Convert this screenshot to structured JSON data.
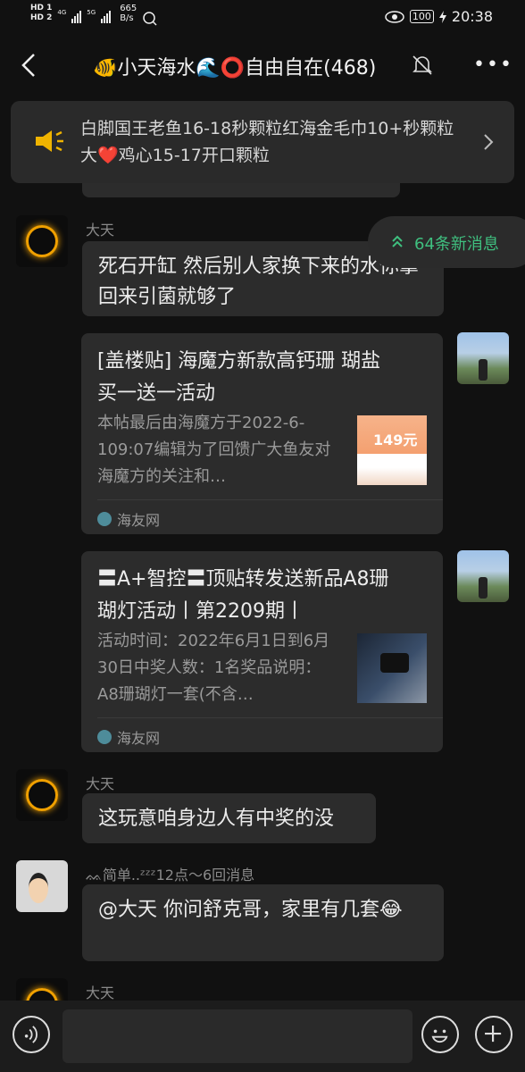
{
  "status_bar": {
    "hd1": "HD 1",
    "hd2": "HD 2",
    "net1": "4G",
    "net2": "5G",
    "speed_value": "665",
    "speed_unit": "B/s",
    "battery": "100",
    "time": "20:38"
  },
  "header": {
    "title": "🐠小天海水🌊⭕自由自在(468)"
  },
  "notice": {
    "text": "白脚国王老鱼16-18秒颗粒红海金毛巾10+秒颗粒大❤️鸡心15-17开口颗粒"
  },
  "new_messages": {
    "label": "64条新消息"
  },
  "messages": [
    {
      "sender": "大天",
      "text": "死石开缸 然后别人家换下来的水你拿回来引菌就够了"
    },
    {
      "card_title": "[盖楼贴] 海魔方新款高钙珊 瑚盐 买一送一活动",
      "card_desc": "本帖最后由海魔方于2022-6-109:07编辑为了回馈广大鱼友对海魔方的关注和…",
      "card_thumb_text": "149元",
      "card_source": "海友网"
    },
    {
      "card_title": "〓A+智控〓顶贴转发送新品A8珊瑚灯活动丨第2209期丨",
      "card_desc": "活动时间：2022年6月1日到6月30日中奖人数：1名奖品说明：A8珊瑚灯一套(不含…",
      "card_source": "海友网"
    },
    {
      "sender": "大天",
      "text": "这玩意咱身边人有中奖的没"
    },
    {
      "sender": "ᨐ简单..ᶻᶻᶻ12点～6回消息",
      "text": "@大天  你问舒克哥，家里有几套😂"
    },
    {
      "sender": "大天"
    }
  ]
}
